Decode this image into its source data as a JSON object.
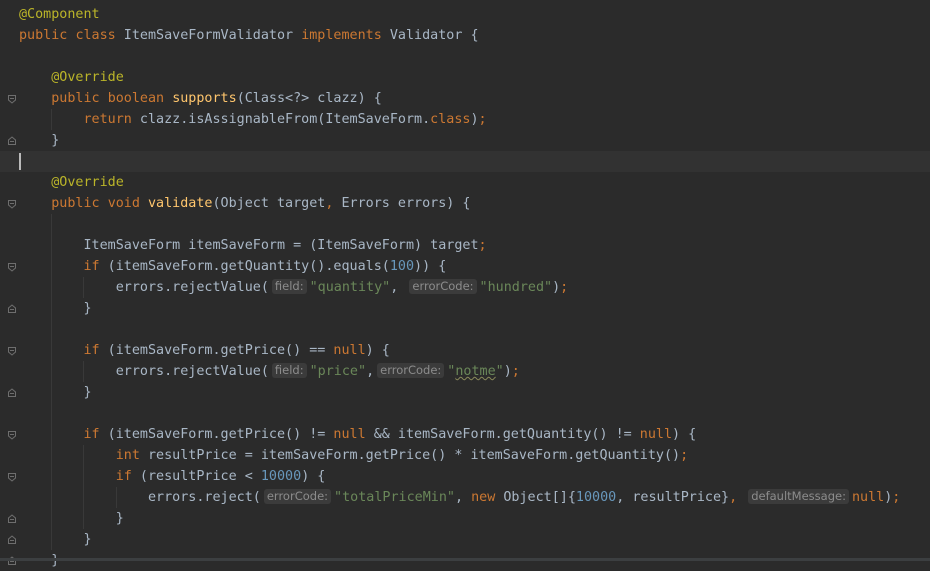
{
  "editor": {
    "lines": [
      {
        "tokens": [
          {
            "t": "@Component",
            "c": "ann"
          }
        ]
      },
      {
        "tokens": [
          {
            "t": "public",
            "c": "kw"
          },
          {
            "t": " "
          },
          {
            "t": "class",
            "c": "kw"
          },
          {
            "t": " ItemSaveFormValidator "
          },
          {
            "t": "implements",
            "c": "kw"
          },
          {
            "t": " Validator {"
          }
        ]
      },
      {
        "tokens": []
      },
      {
        "tokens": [
          {
            "t": "    "
          },
          {
            "t": "@Override",
            "c": "ann"
          }
        ]
      },
      {
        "tokens": [
          {
            "t": "    "
          },
          {
            "t": "public",
            "c": "kw"
          },
          {
            "t": " "
          },
          {
            "t": "boolean",
            "c": "kw"
          },
          {
            "t": " "
          },
          {
            "t": "supports",
            "c": "fn"
          },
          {
            "t": "(Class<?> clazz) {"
          }
        ]
      },
      {
        "tokens": [
          {
            "t": "        "
          },
          {
            "t": "return",
            "c": "kw"
          },
          {
            "t": " clazz.isAssignableFrom(ItemSaveForm."
          },
          {
            "t": "class",
            "c": "kw"
          },
          {
            "t": ")"
          },
          {
            "t": ";",
            "c": "kw"
          }
        ]
      },
      {
        "tokens": [
          {
            "t": "    }"
          }
        ]
      },
      {
        "tokens": []
      },
      {
        "tokens": [
          {
            "t": "    "
          },
          {
            "t": "@Override",
            "c": "ann"
          }
        ]
      },
      {
        "tokens": [
          {
            "t": "    "
          },
          {
            "t": "public",
            "c": "kw"
          },
          {
            "t": " "
          },
          {
            "t": "void",
            "c": "kw"
          },
          {
            "t": " "
          },
          {
            "t": "validate",
            "c": "fn"
          },
          {
            "t": "(Object target"
          },
          {
            "t": ",",
            "c": "kw"
          },
          {
            "t": " Errors errors) {"
          }
        ]
      },
      {
        "tokens": []
      },
      {
        "tokens": [
          {
            "t": "        ItemSaveForm itemSaveForm = (ItemSaveForm) target"
          },
          {
            "t": ";",
            "c": "kw"
          }
        ]
      },
      {
        "tokens": [
          {
            "t": "        "
          },
          {
            "t": "if",
            "c": "kw"
          },
          {
            "t": " (itemSaveForm.getQuantity().equals("
          },
          {
            "t": "100",
            "c": "num"
          },
          {
            "t": ")) {"
          }
        ]
      },
      {
        "tokens": [
          {
            "t": "            errors.rejectValue("
          },
          {
            "h": "field:"
          },
          {
            "t": "\"quantity\"",
            "c": "str"
          },
          {
            "t": ","
          },
          {
            "t": " "
          },
          {
            "h": "errorCode:"
          },
          {
            "t": "\"hundred\"",
            "c": "str"
          },
          {
            "t": ")"
          },
          {
            "t": ";",
            "c": "kw"
          }
        ]
      },
      {
        "tokens": [
          {
            "t": "        }"
          }
        ]
      },
      {
        "tokens": []
      },
      {
        "tokens": [
          {
            "t": "        "
          },
          {
            "t": "if",
            "c": "kw"
          },
          {
            "t": " (itemSaveForm.getPrice() == "
          },
          {
            "t": "null",
            "c": "kw"
          },
          {
            "t": ") {"
          }
        ]
      },
      {
        "tokens": [
          {
            "t": "            errors.rejectValue("
          },
          {
            "h": "field:"
          },
          {
            "t": "\"price\"",
            "c": "str"
          },
          {
            "t": ","
          },
          {
            "h": "errorCode:"
          },
          {
            "t": "\"",
            "c": "str"
          },
          {
            "t": "notme",
            "c": "str warn"
          },
          {
            "t": "\"",
            "c": "str"
          },
          {
            "t": ")"
          },
          {
            "t": ";",
            "c": "kw"
          }
        ]
      },
      {
        "tokens": [
          {
            "t": "        }"
          }
        ]
      },
      {
        "tokens": []
      },
      {
        "tokens": [
          {
            "t": "        "
          },
          {
            "t": "if",
            "c": "kw"
          },
          {
            "t": " (itemSaveForm.getPrice() != "
          },
          {
            "t": "null",
            "c": "kw"
          },
          {
            "t": " && itemSaveForm.getQuantity() != "
          },
          {
            "t": "null",
            "c": "kw"
          },
          {
            "t": ") {"
          }
        ]
      },
      {
        "tokens": [
          {
            "t": "            "
          },
          {
            "t": "int",
            "c": "kw"
          },
          {
            "t": " resultPrice = itemSaveForm.getPrice() * itemSaveForm.getQuantity()"
          },
          {
            "t": ";",
            "c": "kw"
          }
        ]
      },
      {
        "tokens": [
          {
            "t": "            "
          },
          {
            "t": "if",
            "c": "kw"
          },
          {
            "t": " (resultPrice < "
          },
          {
            "t": "10000",
            "c": "num"
          },
          {
            "t": ") {"
          }
        ]
      },
      {
        "tokens": [
          {
            "t": "                errors.reject("
          },
          {
            "h": "errorCode:"
          },
          {
            "t": "\"totalPriceMin\"",
            "c": "str"
          },
          {
            "t": ","
          },
          {
            "t": " "
          },
          {
            "t": "new",
            "c": "kw"
          },
          {
            "t": " Object[]{"
          },
          {
            "t": "10000",
            "c": "num"
          },
          {
            "t": ","
          },
          {
            "t": " resultPrice}"
          },
          {
            "t": ",",
            "c": "kw"
          },
          {
            "t": " "
          },
          {
            "h": "defaultMessage:"
          },
          {
            "t": "null",
            "c": "kw"
          },
          {
            "t": ")"
          },
          {
            "t": ";",
            "c": "kw"
          }
        ]
      },
      {
        "tokens": [
          {
            "t": "            }"
          }
        ]
      },
      {
        "tokens": [
          {
            "t": "        }"
          }
        ]
      },
      {
        "tokens": [
          {
            "t": "    }"
          }
        ]
      }
    ],
    "current_line": 7,
    "fold_open_lines": [
      4,
      9,
      12,
      16,
      20,
      22
    ],
    "fold_close_lines": [
      6,
      14,
      18,
      24,
      25,
      26
    ],
    "colors": {
      "background": "#2b2b2b",
      "current_line": "#323232",
      "keyword": "#cc7832",
      "annotation": "#bbb529",
      "method": "#ffc66d",
      "string": "#6a8759",
      "number": "#6897bb",
      "text": "#a9b7c6",
      "inlay_hint_bg": "#3b3b3b",
      "inlay_hint_text": "#8c8c8c"
    }
  }
}
